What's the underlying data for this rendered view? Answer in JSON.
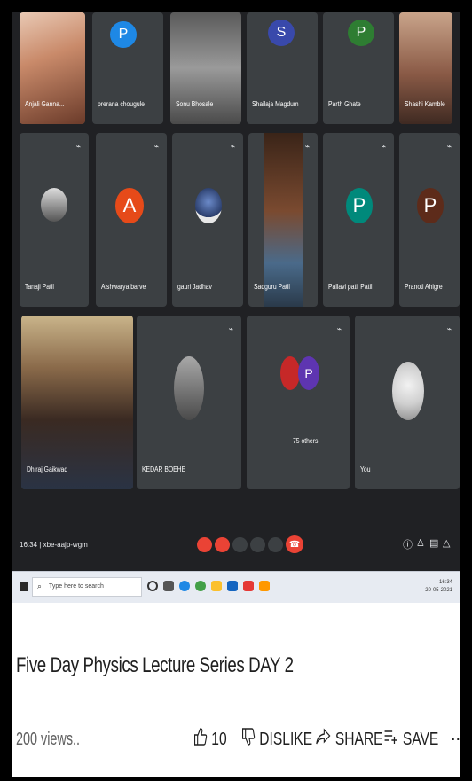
{
  "meeting": {
    "top_row": [
      {
        "name": "Anjali Ganna...",
        "type": "photo"
      },
      {
        "name": "prerana chougule",
        "type": "avatar",
        "initial": "P",
        "color": "#1e88e5"
      },
      {
        "name": "Sonu Bhosale",
        "type": "photo"
      },
      {
        "name": "Shailaja Magdum",
        "type": "avatar",
        "initial": "S",
        "color": "#3949ab"
      },
      {
        "name": "Parth Ghate",
        "type": "avatar",
        "initial": "P",
        "color": "#2e7d32"
      },
      {
        "name": "Shashi Kamble",
        "type": "photo"
      }
    ],
    "middle_row": [
      {
        "name": "Tanaji Patil",
        "type": "photo"
      },
      {
        "name": "Aishwarya barve",
        "type": "avatar",
        "initial": "A",
        "color": "#e64a19"
      },
      {
        "name": "gauri Jadhav",
        "type": "photo"
      },
      {
        "name": "Sadguru Patil",
        "type": "photo"
      },
      {
        "name": "Pallavi patil Patil",
        "type": "avatar",
        "initial": "P",
        "color": "#00897b"
      },
      {
        "name": "Pranoti Ahigre",
        "type": "avatar",
        "initial": "P",
        "color": "#5d2b1a"
      }
    ],
    "bottom_row": [
      {
        "name": "Dhiraj Gaikwad",
        "type": "photo"
      },
      {
        "name": "KEDAR BOEHE",
        "type": "photo"
      },
      {
        "name": "75 others",
        "type": "group",
        "initial": "P",
        "color": "#5e35b1"
      },
      {
        "name": "You",
        "type": "photo"
      }
    ],
    "time": "16:34",
    "meeting_code": "xbe-aajp-wgm"
  },
  "taskbar": {
    "search_placeholder": "Type here to search",
    "clock_time": "16:34",
    "clock_date": "20-05-2021"
  },
  "video": {
    "title": "Five Day Physics Lecture Series DAY 2",
    "views": "200 views..",
    "like_count": "10",
    "dislike_label": "DISLIKE",
    "share_label": "SHARE",
    "save_label": "SAVE",
    "more_label": "..."
  },
  "icons": {
    "like": "thumbs-up-icon",
    "dislike": "thumbs-down-icon",
    "share": "share-icon",
    "save": "save-playlist-icon",
    "more": "more-icon"
  },
  "colors": {
    "meet_background": "#202124",
    "tile_background": "#3c4043",
    "end_call": "#ea4335"
  }
}
